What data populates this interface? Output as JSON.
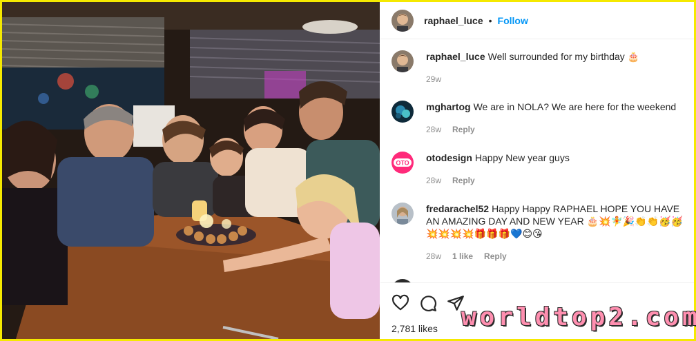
{
  "post": {
    "author": "raphael_luce",
    "follow_label": "Follow",
    "separator": "•",
    "likes": "2,781 likes"
  },
  "comments": [
    {
      "username": "raphael_luce",
      "text": "Well surrounded for my birthday 🎂",
      "time": "29w",
      "likes": "",
      "reply": ""
    },
    {
      "username": "mghartog",
      "text": "We are in NOLA? We are here for the weekend",
      "time": "28w",
      "likes": "",
      "reply": "Reply"
    },
    {
      "username": "otodesign",
      "text": "Happy New year guys",
      "time": "28w",
      "likes": "",
      "reply": "Reply"
    },
    {
      "username": "fredarachel52",
      "text": "Happy Happy RAPHAEL HOPE YOU HAVE AN AMAZING DAY AND NEW YEAR 🎂💥🧚🎉👏👏🥳🥳💥💥💥💥🎁🎁🎁💙😊😘",
      "time": "28w",
      "likes": "1 like",
      "reply": "Reply"
    }
  ],
  "avatar_badges": {
    "otodesign": "OTO"
  },
  "actions": {
    "like": "heart-icon",
    "comment": "comment-icon",
    "share": "share-icon"
  },
  "watermark": "worldtop2.com",
  "colors": {
    "accent": "#0095f6",
    "frame": "#f5e900",
    "watermark": "#ff8fb0"
  }
}
